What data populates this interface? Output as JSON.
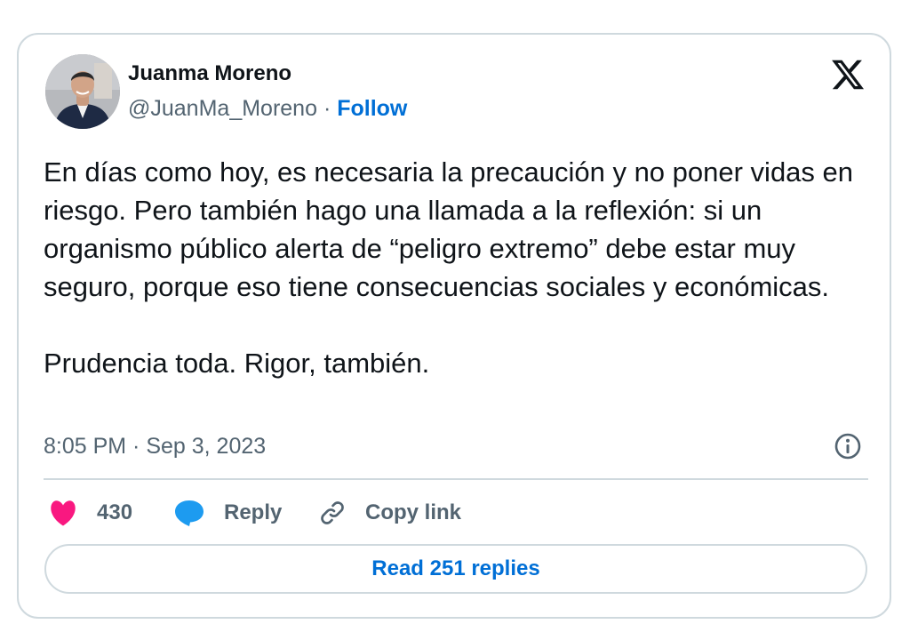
{
  "author": {
    "name": "Juanma Moreno",
    "handle": "@JuanMa_Moreno",
    "separator": " · ",
    "follow_label": "Follow"
  },
  "tweet": {
    "paragraphs": [
      "En días como hoy, es necesaria la precaución y no poner vidas en riesgo. Pero también hago una llamada a la reflexión: si un organismo público alerta de “peligro extremo” debe estar muy seguro, porque eso tiene consecuencias sociales y económicas.",
      "Prudencia toda. Rigor, también."
    ],
    "timestamp": "8:05 PM · Sep 3, 2023"
  },
  "actions": {
    "like_count": "430",
    "reply_label": "Reply",
    "copy_link_label": "Copy link"
  },
  "read_replies_label": "Read 251 replies",
  "icons": {
    "logo": "x-logo-icon",
    "info": "info-icon",
    "like": "heart-icon",
    "reply": "speech-bubble-icon",
    "copy": "link-icon"
  },
  "colors": {
    "like": "#f91880",
    "reply": "#1d9bf0",
    "link_blue": "#006fd6",
    "text_primary": "#0f1419",
    "text_secondary": "#536471",
    "border": "#cfd9de"
  }
}
